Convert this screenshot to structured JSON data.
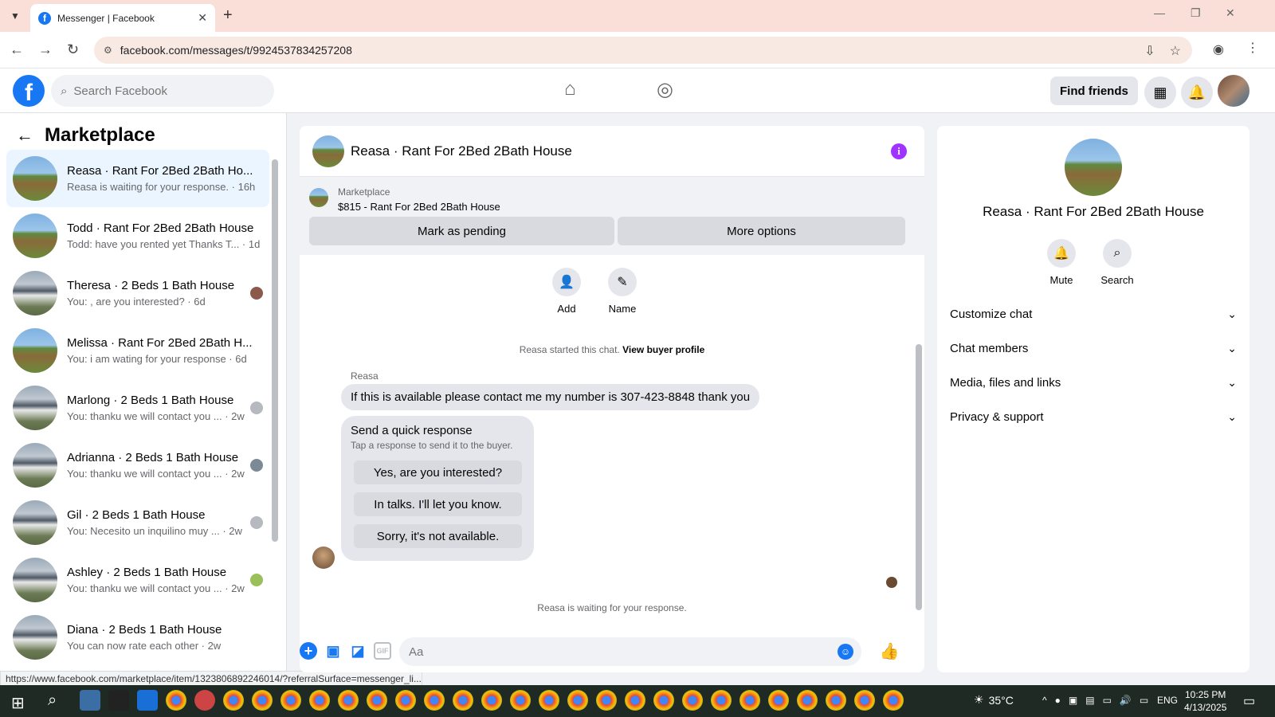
{
  "browser": {
    "tab_title": "Messenger | Facebook",
    "tab_close": "✕",
    "new_tab": "+",
    "url": "facebook.com/messages/t/9924537834257208",
    "status_url": "https://www.facebook.com/marketplace/item/1323806892246014/?referralSurface=messenger_li..."
  },
  "fb_header": {
    "logo_letter": "f",
    "search_placeholder": "Search Facebook",
    "find_friends": "Find friends"
  },
  "left_panel": {
    "title": "Marketplace",
    "conversations": [
      {
        "name": "Reasa · Rant For 2Bed 2Bath Ho...",
        "preview": "Reasa is waiting for your response. · 16h",
        "thumb": "farm"
      },
      {
        "name": "Todd · Rant For 2Bed 2Bath House",
        "preview": "Todd: have you rented yet Thanks T... · 1d",
        "thumb": "farm"
      },
      {
        "name": "Theresa · 2 Beds 1 Bath House",
        "preview": "You: , are you interested? · 6d",
        "thumb": "house"
      },
      {
        "name": "Melissa · Rant For 2Bed 2Bath H...",
        "preview": "You: i am wating for your response · 6d",
        "thumb": "farm"
      },
      {
        "name": "Marlong · 2 Beds 1 Bath House",
        "preview": "You: thanku we will contact you ... · 2w",
        "thumb": "house"
      },
      {
        "name": "Adrianna · 2 Beds 1 Bath House",
        "preview": "You: thanku we will contact you ... · 2w",
        "thumb": "house"
      },
      {
        "name": "Gil · 2 Beds 1 Bath House",
        "preview": "You: Necesito un inquilino muy ... · 2w",
        "thumb": "house"
      },
      {
        "name": "Ashley · 2 Beds 1 Bath House",
        "preview": "You: thanku we will contact you ... · 2w",
        "thumb": "house"
      },
      {
        "name": "Diana · 2 Beds 1 Bath House",
        "preview": "You can now rate each other · 2w",
        "thumb": "house"
      }
    ]
  },
  "chat": {
    "title": "Reasa · Rant For 2Bed 2Bath House",
    "marketplace_label": "Marketplace",
    "listing": "$815 - Rant For 2Bed 2Bath House",
    "mark_pending": "Mark as pending",
    "more_options": "More options",
    "add_label": "Add",
    "name_label": "Name",
    "started_text": "Reasa started this chat.",
    "view_buyer": "View buyer profile",
    "sender_name": "Reasa",
    "message": "If this is available please contact me my number is 307-423-8848 thank you",
    "quick_title": "Send a quick response",
    "quick_sub": "Tap a response to send it to the buyer.",
    "quick_options": [
      "Yes, are you interested?",
      "In talks. I'll let you know.",
      "Sorry, it's not available."
    ],
    "waiting": "Reasa is waiting for your response.",
    "composer_placeholder": "Aa",
    "gif_label": "GIF"
  },
  "right_panel": {
    "name": "Reasa · Rant For 2Bed 2Bath House",
    "mute": "Mute",
    "search": "Search",
    "sections": [
      "Customize chat",
      "Chat members",
      "Media, files and links",
      "Privacy & support"
    ]
  },
  "taskbar": {
    "temperature": "35°C",
    "language": "ENG",
    "time": "10:25 PM",
    "date": "4/13/2025"
  }
}
